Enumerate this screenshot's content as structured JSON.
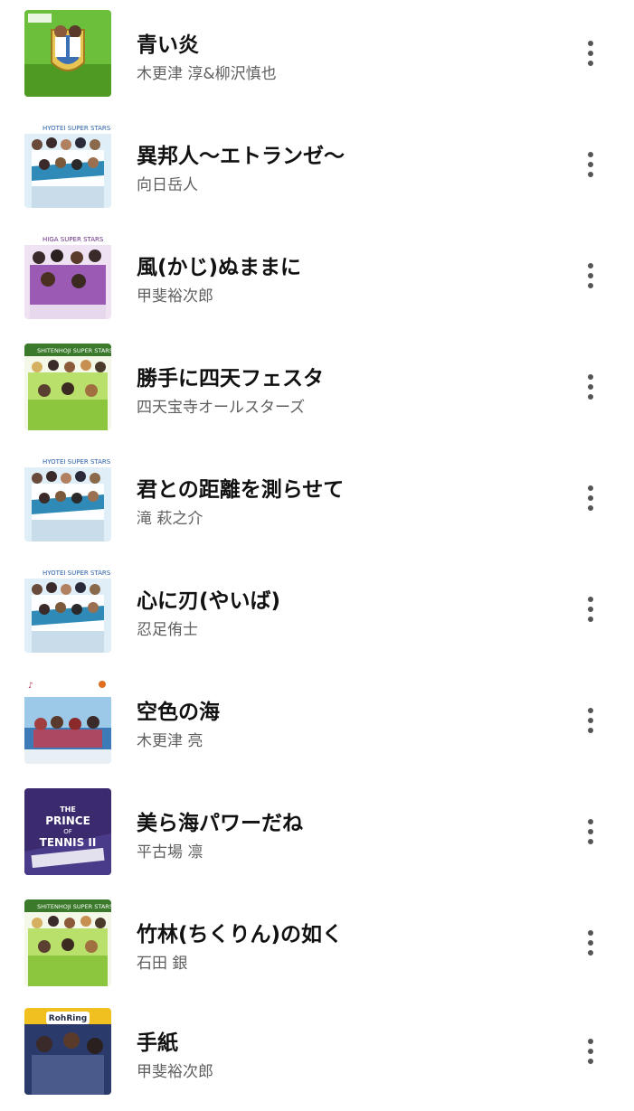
{
  "tracks": [
    {
      "title": "青い炎",
      "artist": "木更津 淳&柳沢慎也",
      "art": {
        "icon": "album-art-green-crest",
        "bg": "#6bbf3a"
      }
    },
    {
      "title": "異邦人～エトランゼ～",
      "artist": "向日岳人",
      "art": {
        "icon": "album-art-hyotei-super-stars",
        "header": "HYOTEI SUPER STARS",
        "bg": "#cfe3f0"
      }
    },
    {
      "title": "風(かじ)ぬままに",
      "artist": "甲斐裕次郎",
      "art": {
        "icon": "album-art-higa-super-stars",
        "header": "HIGA SUPER STARS",
        "bg": "#b98cc8"
      }
    },
    {
      "title": "勝手に四天フェスタ",
      "artist": "四天宝寺オールスターズ",
      "art": {
        "icon": "album-art-shitenhoji-super-stars",
        "header": "SHITENHOJI SUPER STARS",
        "bg": "#a6d36a"
      }
    },
    {
      "title": "君との距離を測らせて",
      "artist": "滝 萩之介",
      "art": {
        "icon": "album-art-hyotei-super-stars",
        "header": "HYOTEI SUPER STARS",
        "bg": "#cfe3f0"
      }
    },
    {
      "title": "心に刃(やいば)",
      "artist": "忍足侑士",
      "art": {
        "icon": "album-art-hyotei-super-stars",
        "header": "HYOTEI SUPER STARS",
        "bg": "#cfe3f0"
      }
    },
    {
      "title": "空色の海",
      "artist": "木更津 亮",
      "art": {
        "icon": "album-art-sky-sea",
        "bg": "#9cc9e8"
      }
    },
    {
      "title": "美ら海パワーだね",
      "artist": "平古場 凛",
      "art": {
        "icon": "album-art-prince-of-tennis-ii",
        "header": "THE PRINCE OF TENNIS II",
        "bg": "#3b2a6e"
      }
    },
    {
      "title": "竹林(ちくりん)の如く",
      "artist": "石田 銀",
      "art": {
        "icon": "album-art-shitenhoji-super-stars",
        "header": "SHITENHOJI SUPER STARS",
        "bg": "#a6d36a"
      }
    },
    {
      "title": "手紙",
      "artist": "甲斐裕次郎",
      "art": {
        "icon": "album-art-rohring",
        "header": "RohRing",
        "bg": "#1f2a44"
      }
    }
  ],
  "more_icon": "more-vert-icon"
}
